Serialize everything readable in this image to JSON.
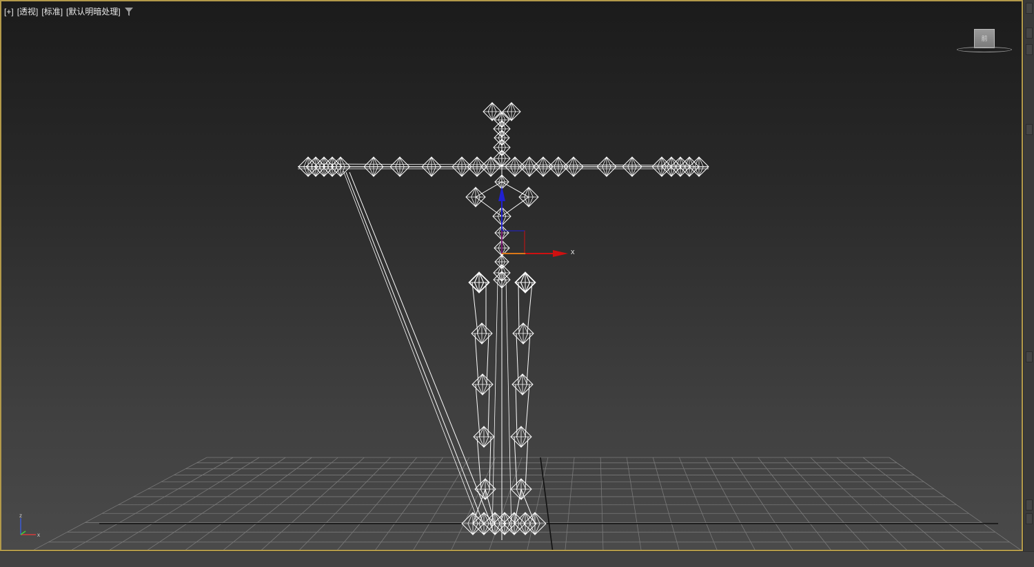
{
  "viewport": {
    "menu": {
      "plus": "[+]",
      "view": "[透视]",
      "shading": "[标准]",
      "lighting": "[默认明暗处理]"
    },
    "viewcube_label": "前",
    "gizmo_x_label": "x",
    "tripod": {
      "z_label": "z",
      "x_label": "x"
    }
  },
  "colors": {
    "viewport_border": "#b39a4a",
    "wireframe": "#ffffff",
    "gizmo_x": "#d01010",
    "gizmo_y": "#e8e020",
    "gizmo_z": "#2020d0",
    "grid": "#7a7a7a"
  },
  "icons": [
    "filter-icon",
    "viewcube-icon",
    "axis-tripod-icon",
    "transform-gizmo-icon"
  ]
}
